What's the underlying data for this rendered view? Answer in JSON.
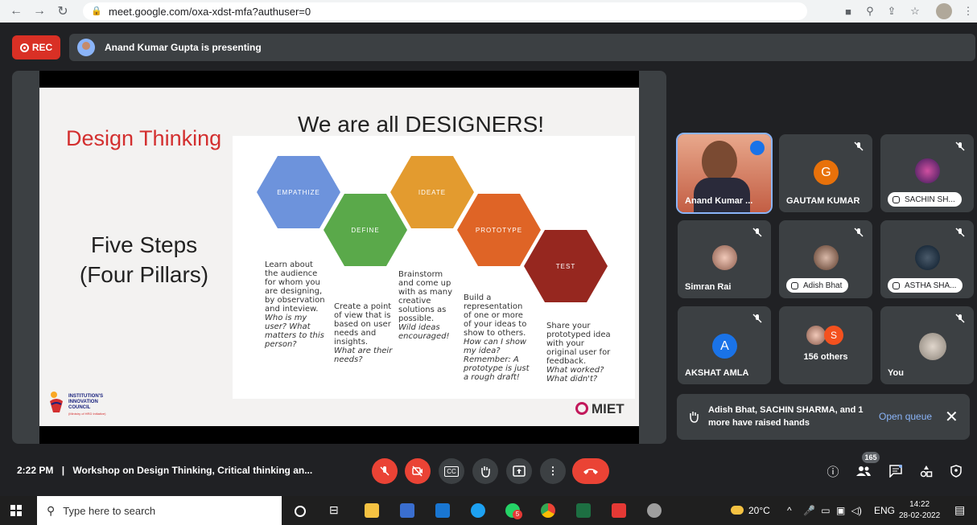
{
  "browser": {
    "url": "meet.google.com/oxa-xdst-mfa?authuser=0"
  },
  "meet": {
    "rec_label": "REC",
    "presenting_text": "Anand Kumar Gupta is presenting",
    "time": "2:22 PM",
    "separator": "|",
    "meeting_title": "Workshop on Design Thinking, Critical thinking an...",
    "participants_count": "165"
  },
  "slide": {
    "title": "We are all DESIGNERS!",
    "side_title": "Design Thinking",
    "steps_line1": "Five Steps",
    "steps_line2": "(Four Pillars)",
    "hexes": [
      {
        "label": "Empathize",
        "color": "#6d93dc"
      },
      {
        "label": "Define",
        "color": "#5aa94a"
      },
      {
        "label": "Ideate",
        "color": "#e39b2f"
      },
      {
        "label": "Prototype",
        "color": "#df6426"
      },
      {
        "label": "Test",
        "color": "#96271f"
      }
    ],
    "texts": {
      "empathize": "Learn about the audience for whom you are designing, by observation and inteview.",
      "empathize_q": "Who is my user? What matters to this person?",
      "define": "Create a point of view that is based on user needs and insights.",
      "define_q": "What are their needs?",
      "ideate": "Brainstorm and come up with as many creative solutions as possible.",
      "ideate_q": "Wild ideas encouraged!",
      "prototype": "Build a representation of one or more of your ideas to show to others.",
      "prototype_q": "How can I show my idea? Remember: A prototype is just a rough draft!",
      "test": "Share your prototyped idea with your original user for feedback.",
      "test_q": "What worked? What didn't?"
    },
    "logo_text": "INSTITUTION'S INNOVATION COUNCIL",
    "logo_sub": "(Ministry of HRD Initiative)",
    "brand": "MIET"
  },
  "tiles": [
    {
      "name": "Anand Kumar ...",
      "type": "photo"
    },
    {
      "name": "GAUTAM KUMAR",
      "letter": "G",
      "color": "#e8710a"
    },
    {
      "name": "SACHIN SH...",
      "type": "photo",
      "hand": true
    },
    {
      "name": "Simran Rai",
      "type": "photo"
    },
    {
      "name": "Adish Bhat",
      "type": "photo",
      "hand": true
    },
    {
      "name": "ASTHA SHA...",
      "type": "photo",
      "hand": true
    },
    {
      "name": "AKSHAT AMLA",
      "letter": "A",
      "color": "#1a73e8"
    },
    {
      "name": "156 others",
      "letter": "S",
      "color": "#f4511e"
    },
    {
      "name": "You",
      "type": "photo"
    }
  ],
  "hands": {
    "text": "Adish Bhat, SACHIN SHARMA, and 1 more have raised hands",
    "action": "Open queue"
  },
  "taskbar": {
    "search_placeholder": "Type here to search",
    "weather": "20°C",
    "lang": "ENG",
    "clock_time": "14:22",
    "clock_date": "28-02-2022",
    "chrome_badge": "5"
  }
}
